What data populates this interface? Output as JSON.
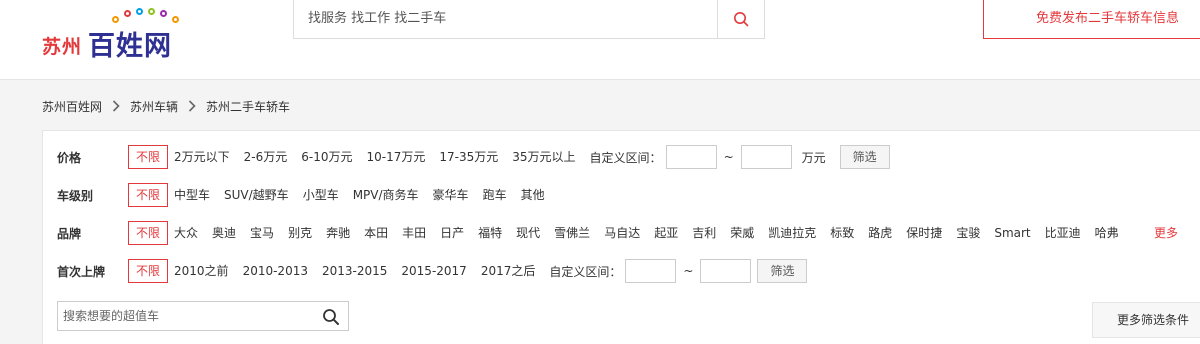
{
  "header": {
    "logo_city": "苏州",
    "logo_brand": "百姓网",
    "search_placeholder": "找服务 找工作 找二手车",
    "post_button": "免费发布二手车轿车信息"
  },
  "breadcrumb": [
    "苏州百姓网",
    "苏州车辆",
    "苏州二手车轿车"
  ],
  "filters": {
    "price": {
      "label": "价格",
      "selected": "不限",
      "options": [
        "2万元以下",
        "2-6万元",
        "6-10万元",
        "10-17万元",
        "17-35万元",
        "35万元以上"
      ],
      "range_label": "自定义区间：",
      "tilde": "~",
      "unit": "万元",
      "button": "筛选"
    },
    "level": {
      "label": "车级别",
      "selected": "不限",
      "options": [
        "中型车",
        "SUV/越野车",
        "小型车",
        "MPV/商务车",
        "豪华车",
        "跑车",
        "其他"
      ]
    },
    "brand": {
      "label": "品牌",
      "selected": "不限",
      "options": [
        "大众",
        "奥迪",
        "宝马",
        "别克",
        "奔驰",
        "本田",
        "丰田",
        "日产",
        "福特",
        "现代",
        "雪佛兰",
        "马自达",
        "起亚",
        "吉利",
        "荣威",
        "凯迪拉克",
        "标致",
        "路虎",
        "保时捷",
        "宝骏",
        "Smart",
        "比亚迪",
        "哈弗"
      ],
      "more": "更多"
    },
    "first_reg": {
      "label": "首次上牌",
      "selected": "不限",
      "options": [
        "2010之前",
        "2010-2013",
        "2013-2015",
        "2015-2017",
        "2017之后"
      ],
      "range_label": "自定义区间：",
      "tilde": "~",
      "button": "筛选"
    }
  },
  "keyword_search": {
    "placeholder": "搜索想要的超值车"
  },
  "more_conditions": "更多筛选条件",
  "colors": {
    "accent": "#e4393c",
    "brand_blue": "#2e3192"
  }
}
